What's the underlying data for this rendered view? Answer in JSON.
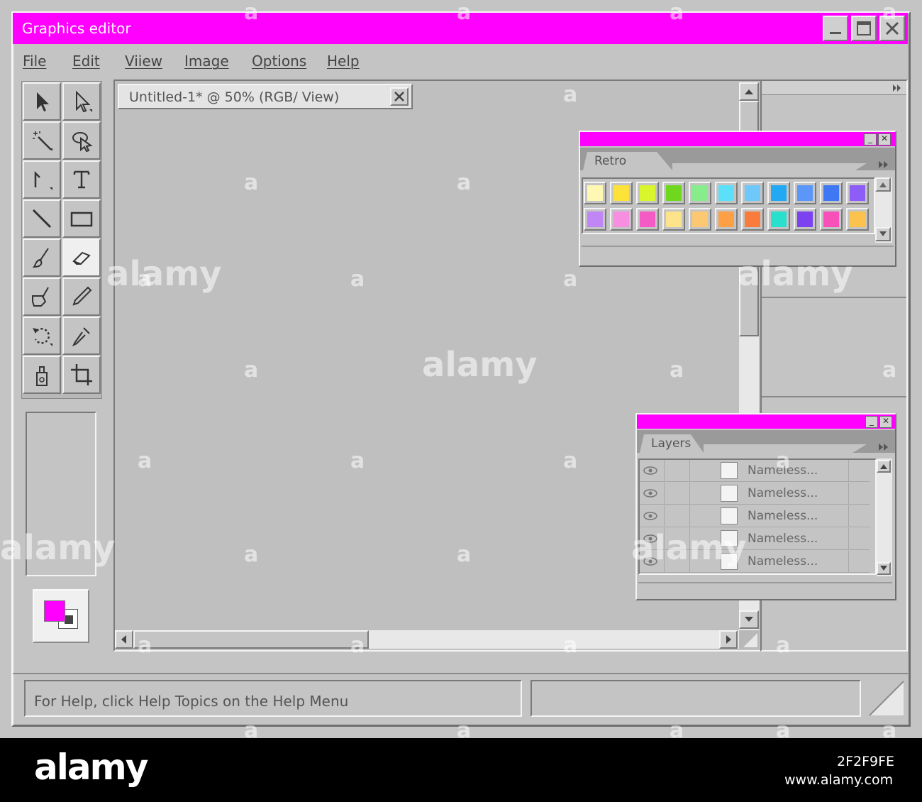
{
  "window": {
    "title": "Graphics editor",
    "minimize_label": "_",
    "maximize_label": "□",
    "close_label": "✕"
  },
  "menu": {
    "items": [
      "File",
      "Edit",
      "Viiew",
      "Image",
      "Options",
      "Help"
    ]
  },
  "tools": [
    "pointer",
    "direct-select",
    "magic-wand",
    "lasso",
    "pen",
    "text",
    "line",
    "rectangle",
    "brush",
    "eraser",
    "fill-brush",
    "pencil",
    "rotate",
    "eyedropper",
    "spray-bottle",
    "crop"
  ],
  "document": {
    "tab_title": "Untitled-1* @ 50% (RGB/ View)",
    "close_label": "✕"
  },
  "colors": {
    "accent": "#ff00ff",
    "foreground": "#ff00ff",
    "background": "#444444"
  },
  "swatches_panel": {
    "tab_label": "Retro",
    "row1": [
      "#fff8b4",
      "#fde23a",
      "#d9f52b",
      "#6fd81e",
      "#86ed8a",
      "#5ce0fa",
      "#6fc8fa",
      "#21a9f4",
      "#5b97f8",
      "#3f78f3",
      "#8e5cf7"
    ],
    "row2": [
      "#c086f5",
      "#f88ee2",
      "#f55bc4",
      "#fde38a",
      "#fcc872",
      "#fc9f45",
      "#fa7c3c",
      "#28e0cc",
      "#7d42f0",
      "#f84fb9",
      "#fcc24e"
    ]
  },
  "layers_panel": {
    "tab_label": "Layers",
    "rows": [
      {
        "name": "Nameless..."
      },
      {
        "name": "Nameless..."
      },
      {
        "name": "Nameless..."
      },
      {
        "name": "Nameless..."
      },
      {
        "name": "Nameless..."
      }
    ]
  },
  "statusbar": {
    "help_text": "For Help, click Help Topics on the Help Menu",
    "secondary_text": ""
  },
  "watermark": {
    "text": "alamy",
    "small_mark": "a",
    "footer_logo": "alamy",
    "image_id": "2F2F9FE",
    "site": "www.alamy.com"
  }
}
